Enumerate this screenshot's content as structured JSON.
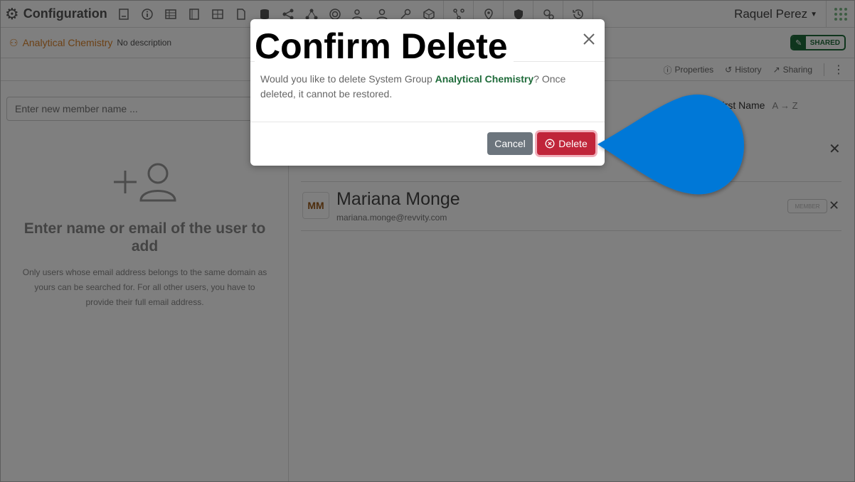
{
  "app": {
    "title": "Configuration",
    "user_name": "Raquel Perez",
    "toolbar_icons": [
      "form-icon",
      "info-icon",
      "table-icon",
      "book-icon",
      "grid-icon",
      "file-icon",
      "database-icon",
      "share-icon",
      "network-icon",
      "target-icon",
      "users-icon",
      "user-icon",
      "key-icon",
      "cube-icon",
      "workflow-icon",
      "location-icon",
      "shield-icon",
      "settings-icon",
      "history-icon"
    ]
  },
  "group": {
    "name": "Analytical Chemistry",
    "description": "No description",
    "shared_label": "SHARED"
  },
  "actions": {
    "properties": "Properties",
    "history": "History",
    "sharing": "Sharing"
  },
  "left_pane": {
    "input_placeholder": "Enter new member name ...",
    "empty_title": "Enter name or email of the user to add",
    "empty_text": "Only users whose email address belongs to the same domain as yours can be searched for. For all other users, you have to provide their full email address."
  },
  "right_pane": {
    "sort_field": "First Name",
    "sort_direction": "A → Z",
    "members": [
      {
        "initials": "MM",
        "name": "Mariana Monge",
        "email": "mariana.monge@revvity.com",
        "role": "MEMBER"
      }
    ]
  },
  "modal": {
    "title": "Confirm Delete",
    "body_prefix": "Would you like to delete System Group ",
    "body_group": "Analytical Chemistry",
    "body_suffix": "? Once deleted, it cannot be restored.",
    "cancel_label": "Cancel",
    "delete_label": "Delete"
  },
  "colors": {
    "accent_green": "#1f6b3a",
    "group_orange": "#d9822b",
    "delete_red": "#c0253a",
    "cancel_gray": "#6c757d",
    "callout_blue": "#0078d7"
  }
}
